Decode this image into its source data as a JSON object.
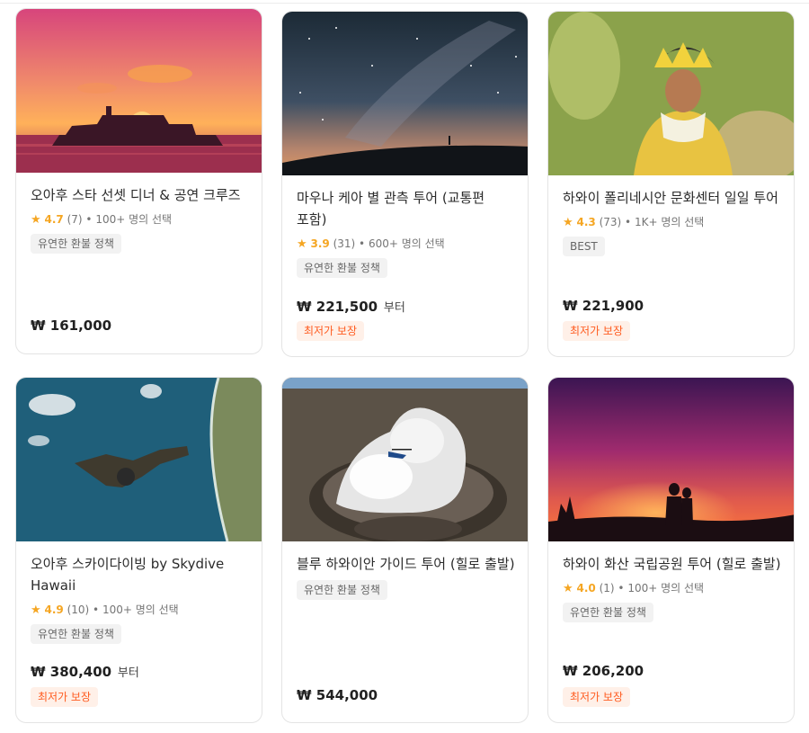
{
  "colors": {
    "rating_star": "#f5a623",
    "badge_text": "#ff5b1f",
    "badge_bg": "#fff0e8",
    "tag_bg": "#f2f2f2"
  },
  "cards": [
    {
      "image": "sunset-cruise-ship",
      "title": "오아후 스타 선셋 디너 & 공연 크루즈",
      "star_icon": "★",
      "rating": "4.7",
      "reviews": "(7)",
      "sep": "•",
      "selections": "100+ 명의 선택",
      "tag": "유연한 환불 정책",
      "price": "₩ 161,000",
      "price_suffix": "",
      "badge": ""
    },
    {
      "image": "milky-way-mountain-silhouette",
      "title": "마우나 케아 별 관측 투어 (교통편 포함)",
      "star_icon": "★",
      "rating": "3.9",
      "reviews": "(31)",
      "sep": "•",
      "selections": "600+ 명의 선택",
      "tag": "유연한 환불 정책",
      "price": "₩ 221,500",
      "price_suffix": "부터",
      "badge": "최저가 보장"
    },
    {
      "image": "polynesian-dancer",
      "title": "하와이 폴리네시안 문화센터 일일 투어",
      "star_icon": "★",
      "rating": "4.3",
      "reviews": "(73)",
      "sep": "•",
      "selections": "1K+ 명의 선택",
      "tag": "BEST",
      "price": "₩ 221,900",
      "price_suffix": "",
      "badge": "최저가 보장"
    },
    {
      "image": "tandem-skydive-over-coast",
      "title": "오아후 스카이다이빙 by Skydive Hawaii",
      "star_icon": "★",
      "rating": "4.9",
      "reviews": "(10)",
      "sep": "•",
      "selections": "100+ 명의 선택",
      "tag": "유연한 환불 정책",
      "price": "₩ 380,400",
      "price_suffix": "부터",
      "badge": "최저가 보장"
    },
    {
      "image": "volcano-crater-helicopter",
      "title": "블루 하와이안 가이드 투어 (힐로 출발)",
      "star_icon": "",
      "rating": "",
      "reviews": "",
      "sep": "",
      "selections": "",
      "tag": "유연한 환불 정책",
      "price": "₩ 544,000",
      "price_suffix": "",
      "badge": ""
    },
    {
      "image": "volcano-glow-couple",
      "title": "하와이 화산 국립공원 투어 (힐로 출발)",
      "star_icon": "★",
      "rating": "4.0",
      "reviews": "(1)",
      "sep": "•",
      "selections": "100+ 명의 선택",
      "tag": "유연한 환불 정책",
      "price": "₩ 206,200",
      "price_suffix": "",
      "badge": "최저가 보장"
    }
  ]
}
